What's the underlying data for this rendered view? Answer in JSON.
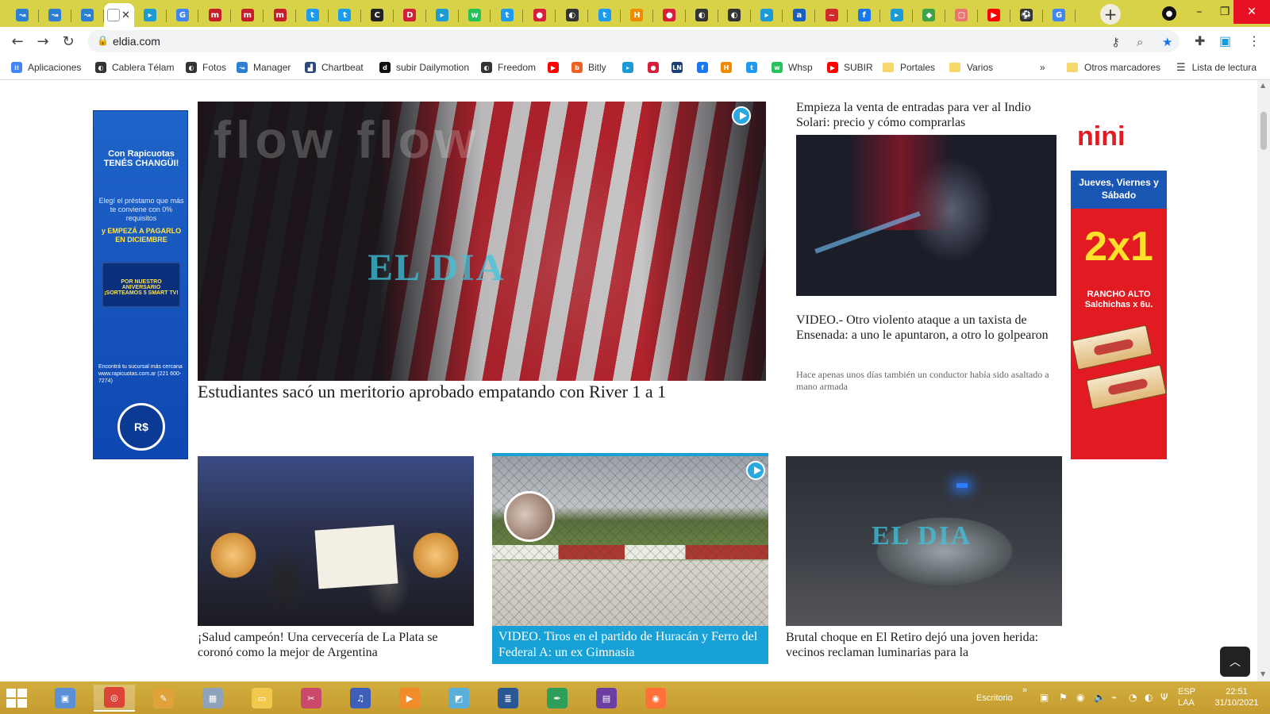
{
  "browser": {
    "tabs": [
      {
        "icon": "tab-icon-bird",
        "glyph": "↝",
        "color": "#2d7fd3"
      },
      {
        "icon": "tab-icon-bird",
        "glyph": "↝",
        "color": "#2d7fd3"
      },
      {
        "icon": "tab-icon-bird",
        "glyph": "↝",
        "color": "#2d7fd3"
      },
      {
        "icon": "tab-icon-blank",
        "glyph": "",
        "color": "#ffffff",
        "active": true
      },
      {
        "icon": "tab-icon-teal",
        "glyph": "▸",
        "color": "#1b9ad6"
      },
      {
        "icon": "tab-icon-google",
        "glyph": "G",
        "color": "#4285f4"
      },
      {
        "icon": "tab-icon-mi",
        "glyph": "m",
        "color": "#c61d2b"
      },
      {
        "icon": "tab-icon-mi",
        "glyph": "m",
        "color": "#c61d2b"
      },
      {
        "icon": "tab-icon-mi",
        "glyph": "m",
        "color": "#c61d2b"
      },
      {
        "icon": "tab-icon-twitter",
        "glyph": "t",
        "color": "#1d9bf0"
      },
      {
        "icon": "tab-icon-twitter",
        "glyph": "t",
        "color": "#1d9bf0"
      },
      {
        "icon": "tab-icon-c",
        "glyph": "C",
        "color": "#222222"
      },
      {
        "icon": "tab-icon-dj",
        "glyph": "D",
        "color": "#d0213b"
      },
      {
        "icon": "tab-icon-teal",
        "glyph": "▸",
        "color": "#1b9ad6"
      },
      {
        "icon": "tab-icon-whatsapp",
        "glyph": "w",
        "color": "#25c25a"
      },
      {
        "icon": "tab-icon-twitter",
        "glyph": "t",
        "color": "#1d9bf0"
      },
      {
        "icon": "tab-icon-ball",
        "glyph": "●",
        "color": "#d81f3a"
      },
      {
        "icon": "tab-icon-globe",
        "glyph": "◐",
        "color": "#333333"
      },
      {
        "icon": "tab-icon-twitter",
        "glyph": "t",
        "color": "#1d9bf0"
      },
      {
        "icon": "tab-icon-h",
        "glyph": "H",
        "color": "#f08a00"
      },
      {
        "icon": "tab-icon-ball",
        "glyph": "●",
        "color": "#d81f3a"
      },
      {
        "icon": "tab-icon-globe",
        "glyph": "◐",
        "color": "#333333"
      },
      {
        "icon": "tab-icon-globe",
        "glyph": "◐",
        "color": "#333333"
      },
      {
        "icon": "tab-icon-teal",
        "glyph": "▸",
        "color": "#1b9ad6"
      },
      {
        "icon": "tab-icon-a",
        "glyph": "a",
        "color": "#1a5fbf"
      },
      {
        "icon": "tab-icon-red",
        "glyph": "~",
        "color": "#d12a2a"
      },
      {
        "icon": "tab-icon-facebook",
        "glyph": "f",
        "color": "#1877f2"
      },
      {
        "icon": "tab-icon-teal",
        "glyph": "▸",
        "color": "#1b9ad6"
      },
      {
        "icon": "tab-icon-green",
        "glyph": "◆",
        "color": "#3da34a"
      },
      {
        "icon": "tab-icon-pink",
        "glyph": "▢",
        "color": "#e8766f"
      },
      {
        "icon": "tab-icon-youtube",
        "glyph": "▶",
        "color": "#ff0000"
      },
      {
        "icon": "tab-icon-soccer",
        "glyph": "⚽",
        "color": "#333333"
      },
      {
        "icon": "tab-icon-google",
        "glyph": "G",
        "color": "#4285f4"
      }
    ],
    "address": "eldia.com",
    "tray_colors": {
      "accent": "#d7d248"
    }
  },
  "bookmarks": [
    {
      "label": "Aplicaciones",
      "icon": "apps-grid-icon",
      "color": "#4285f4",
      "glyph": "⁞⁞"
    },
    {
      "label": "Cablera Télam",
      "icon": "globe-icon",
      "color": "#333333",
      "glyph": "◐"
    },
    {
      "label": "Fotos",
      "icon": "globe-icon",
      "color": "#333333",
      "glyph": "◐"
    },
    {
      "label": "Manager",
      "icon": "bird-icon",
      "color": "#2d7fd3",
      "glyph": "↝"
    },
    {
      "label": "Chartbeat",
      "icon": "chartbeat-icon",
      "color": "#2b4a7a",
      "glyph": "▟"
    },
    {
      "label": "subir Dailymotion",
      "icon": "dailymotion-icon",
      "color": "#111111",
      "glyph": "d"
    },
    {
      "label": "Freedom",
      "icon": "globe-icon",
      "color": "#333333",
      "glyph": "◐"
    },
    {
      "label": "",
      "icon": "youtube-icon",
      "color": "#ff0000",
      "glyph": "▶"
    },
    {
      "label": "Bitly",
      "icon": "bitly-icon",
      "color": "#ee6123",
      "glyph": "b"
    },
    {
      "label": "",
      "icon": "teal-icon",
      "color": "#1b9ad6",
      "glyph": "▸"
    },
    {
      "label": "",
      "icon": "ball-icon",
      "color": "#d81f3a",
      "glyph": "●"
    },
    {
      "label": "",
      "icon": "ln-icon",
      "color": "#1b3f73",
      "glyph": "LN"
    },
    {
      "label": "",
      "icon": "facebook-icon",
      "color": "#1877f2",
      "glyph": "f"
    },
    {
      "label": "",
      "icon": "h-icon",
      "color": "#f08a00",
      "glyph": "H"
    },
    {
      "label": "",
      "icon": "twitter-icon",
      "color": "#1d9bf0",
      "glyph": "t"
    },
    {
      "label": "Whsp",
      "icon": "whatsapp-icon",
      "color": "#25c25a",
      "glyph": "w"
    },
    {
      "label": "SUBIR",
      "icon": "youtube-icon",
      "color": "#ff0000",
      "glyph": "▶"
    },
    {
      "label": "Portales",
      "icon": "folder-icon",
      "color": "#f6d76a",
      "glyph": ""
    },
    {
      "label": "Varios",
      "icon": "folder-icon",
      "color": "#f6d76a",
      "glyph": ""
    }
  ],
  "bookmarks_overflow": "»",
  "other_bookmarks": "Otros marcadores",
  "reading_list": "Lista de lectura",
  "left_ad": {
    "headline": "Con Rapicuotas TENÉS CHANGÜI!",
    "body": "Elegí el préstamo que más te conviene con 0% requisitos",
    "cta": "y EMPEZÁ A PAGARLO EN DICIEMBRE",
    "tv_text": "POR NUESTRO ANIVERSARIO ¡SORTEAMOS 5 SMART TV!",
    "footer": "Encontrá tu sucursal más cercana www.rapicuotas.com.ar (221 600-7274)",
    "seal": "R$"
  },
  "hero": {
    "title": "Estudiantes sacó un meritorio aprobado empatando con River 1 a 1",
    "watermark": "EL DIA"
  },
  "side": {
    "story1_title": "Empieza la venta de entradas para ver al Indio Solari: precio y cómo comprarlas",
    "story2_title": "VIDEO.- Otro violento ataque a un taxista de Ensenada: a uno le apuntaron, a otro lo golpearon",
    "story2_sub": "Hace apenas unos días también un conductor había sido asaltado a mano armada"
  },
  "right_ad": {
    "logo": "nini",
    "days": "Jueves, Viernes y Sábado",
    "promo": "2x1",
    "product": "RANCHO ALTO Salchichas x 6u."
  },
  "cards": [
    {
      "title": "¡Salud campeón! Una cervecería de La Plata se coronó como la mejor de Argentina"
    },
    {
      "title": "VIDEO. Tiros en el partido de Huracán y Ferro del Federal A: un ex Gimnasia"
    },
    {
      "title": "Brutal choque en El Retiro dejó una joven herida: vecinos reclaman luminarias para la",
      "watermark": "EL DIA"
    }
  ],
  "taskbar": {
    "apps": [
      {
        "icon": "image-viewer-icon",
        "color": "#5b8fd6",
        "glyph": "▣"
      },
      {
        "icon": "chrome-icon",
        "color": "#db4437",
        "glyph": "◎",
        "active": true
      },
      {
        "icon": "paint-icon",
        "color": "#e0a23a",
        "glyph": "✎"
      },
      {
        "icon": "calculator-icon",
        "color": "#8ea3b9",
        "glyph": "▦"
      },
      {
        "icon": "file-explorer-icon",
        "color": "#f2c94c",
        "glyph": "▭"
      },
      {
        "icon": "snip-icon",
        "color": "#c94a6b",
        "glyph": "✂"
      },
      {
        "icon": "media-icon",
        "color": "#3d5fb8",
        "glyph": "♫"
      },
      {
        "icon": "player-icon",
        "color": "#f08c2a",
        "glyph": "▶"
      },
      {
        "icon": "notes-icon",
        "color": "#5ab0d8",
        "glyph": "◩"
      },
      {
        "icon": "document-icon",
        "color": "#2b5797",
        "glyph": "≣"
      },
      {
        "icon": "pen-icon",
        "color": "#2e9e5b",
        "glyph": "✒"
      },
      {
        "icon": "video-editor-icon",
        "color": "#6b3fa0",
        "glyph": "▤"
      },
      {
        "icon": "firefox-icon",
        "color": "#ff7139",
        "glyph": "◉"
      }
    ],
    "desktop_label": "Escritorio",
    "lang": "ESP",
    "layout": "LAA",
    "time": "22:51",
    "date": "31/10/2021"
  }
}
